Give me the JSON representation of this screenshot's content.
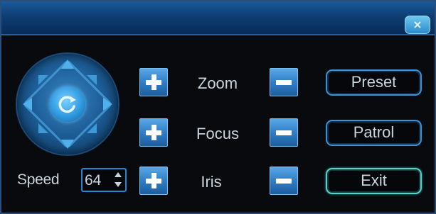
{
  "window": {
    "close_label": "×"
  },
  "ptz": {
    "center_icon": "rotate-icon",
    "directions": [
      "up",
      "down",
      "left",
      "right",
      "up-left",
      "up-right",
      "down-left",
      "down-right"
    ]
  },
  "speed": {
    "label": "Speed",
    "value": "64"
  },
  "controls": [
    {
      "label": "Zoom",
      "plus": "+",
      "minus": "−"
    },
    {
      "label": "Focus",
      "plus": "+",
      "minus": "−"
    },
    {
      "label": "Iris",
      "plus": "+",
      "minus": "−"
    }
  ],
  "buttons": {
    "preset": "Preset",
    "patrol": "Patrol",
    "exit": "Exit"
  },
  "colors": {
    "accent": "#2f7ec7",
    "titlebar": "#0e3e73",
    "text": "#c9d4de",
    "exit_border": "#5ed0c8"
  }
}
